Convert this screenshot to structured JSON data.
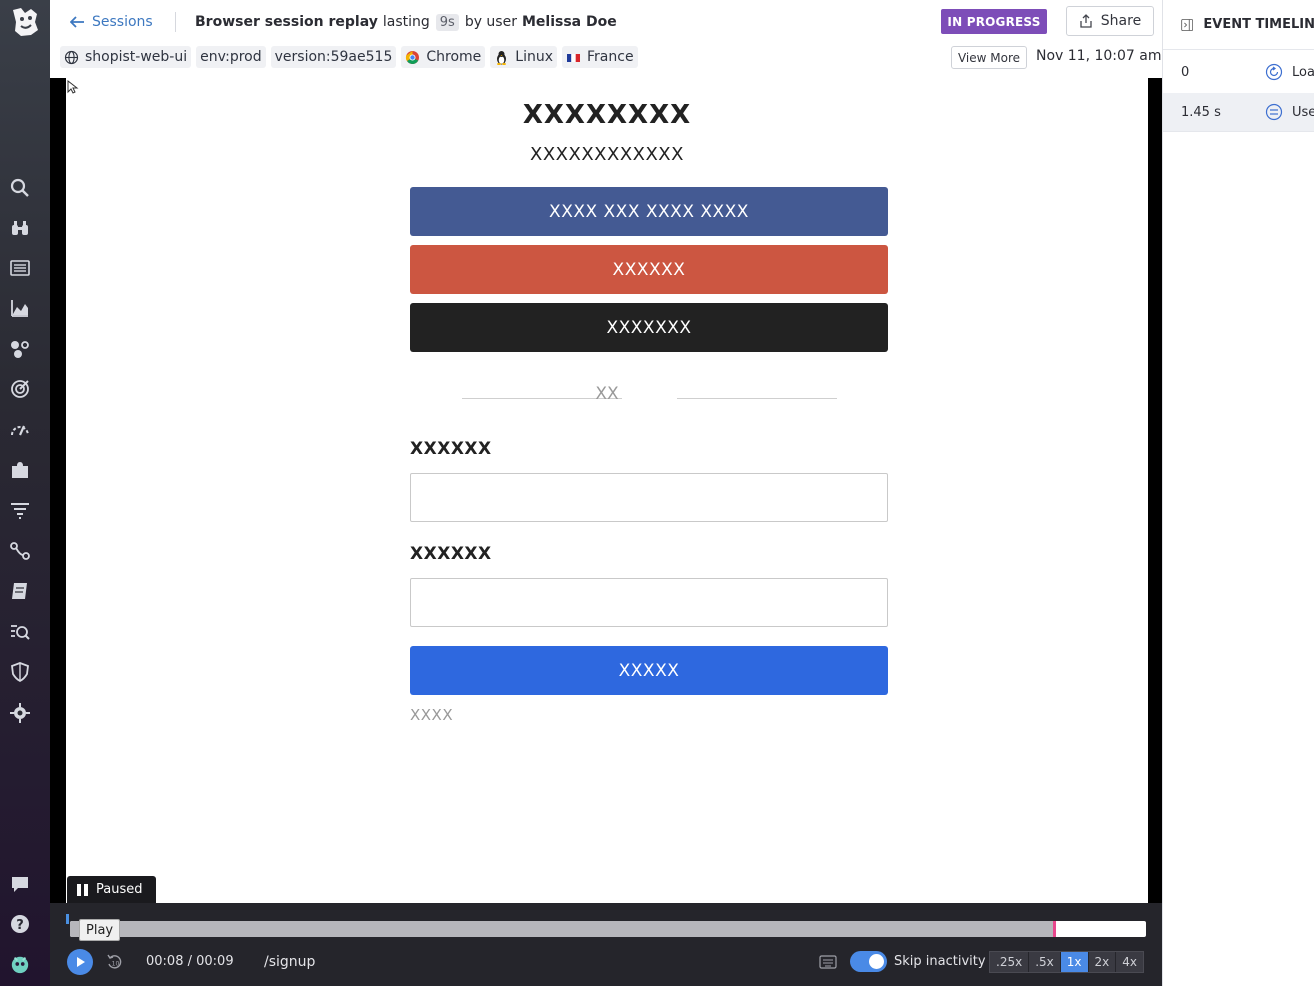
{
  "header": {
    "back_label": "Sessions",
    "title_prefix": "Browser session replay",
    "title_lasting": "lasting",
    "duration": "9s",
    "title_by_user": "by user",
    "user_name": "Melissa Doe",
    "status_badge": "IN PROGRESS",
    "share_label": "Share",
    "view_more_label": "View More",
    "datetime": "Nov 11, 10:07 am",
    "tags": [
      {
        "label": "shopist-web-ui",
        "icon": "globe-icon"
      },
      {
        "label": "env:prod",
        "icon": ""
      },
      {
        "label": "version:59ae515",
        "icon": ""
      },
      {
        "label": "Chrome",
        "icon": "chrome-icon"
      },
      {
        "label": "Linux",
        "icon": "linux-icon"
      },
      {
        "label": "France",
        "icon": "france-flag-icon"
      }
    ]
  },
  "replay": {
    "title": "XXXXXXXX",
    "subtitle": "XXXXXXXXXXXX",
    "buttons": [
      "XXXX XXX XXXX XXXX",
      "XXXXXX",
      "XXXXXXX"
    ],
    "divider_text": "XX",
    "field_labels": [
      "XXXXXX",
      "XXXXXX"
    ],
    "submit_label": "XXXXX",
    "link_text": "XXXX",
    "paused_label": "Paused"
  },
  "player": {
    "play_tooltip": "Play",
    "time_current": "00:08",
    "time_total": "00:09",
    "progress_fraction": 0.914,
    "url_path": "/signup",
    "skip_inactivity_label": "Skip inactivity",
    "skip_inactivity_on": true,
    "speeds": [
      ".25x",
      ".5x",
      "1x",
      "2x",
      "4x"
    ],
    "active_speed": "1x"
  },
  "panel": {
    "title": "EVENT TIMELIN",
    "events": [
      {
        "time": "0",
        "label": "Loa",
        "icon": "reload-icon"
      },
      {
        "time": "1.45 s",
        "label": "Use",
        "icon": "user-action-icon"
      }
    ]
  },
  "nav": {
    "icons": [
      "search-icon",
      "binoculars-icon",
      "list-icon",
      "chart-icon",
      "integrations-icon",
      "target-icon",
      "gauge-icon",
      "puzzle-icon",
      "filter-icon",
      "path-icon",
      "notebook-icon",
      "watchdog-icon",
      "shield-icon",
      "security-icon",
      "chat-icon",
      "help-icon",
      "avatar-icon"
    ]
  },
  "colors": {
    "accent": "#4a8ae6",
    "badge": "#7d4db8",
    "facebook": "#445a93",
    "google": "#cc5641",
    "submit": "#2e68df",
    "marker": "#e8478d"
  }
}
